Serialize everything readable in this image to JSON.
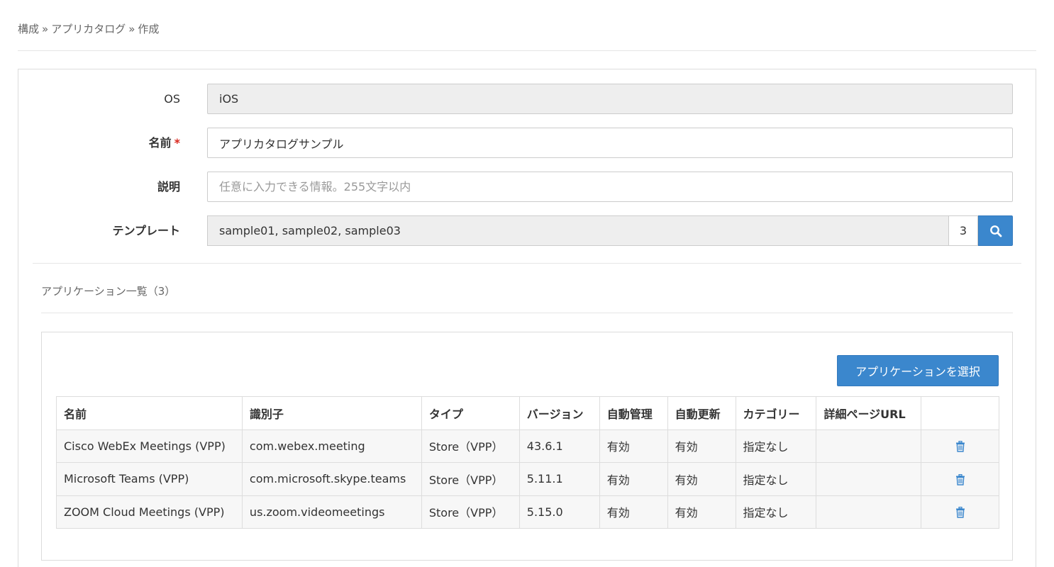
{
  "breadcrumb": {
    "items": [
      "構成",
      "アプリカタログ",
      "作成"
    ],
    "separator": "»"
  },
  "form": {
    "os": {
      "label": "OS",
      "value": "iOS"
    },
    "name": {
      "label": "名前",
      "required_mark": "*",
      "value": "アプリカタログサンプル"
    },
    "description": {
      "label": "説明",
      "value": "",
      "placeholder": "任意に入力できる情報。255文字以内"
    },
    "template": {
      "label": "テンプレート",
      "value": "sample01, sample02, sample03",
      "count": "3",
      "search_icon": "search-icon"
    }
  },
  "app_list": {
    "title": "アプリケーション一覧（3）",
    "select_button": "アプリケーションを選択",
    "columns": [
      "名前",
      "識別子",
      "タイプ",
      "バージョン",
      "自動管理",
      "自動更新",
      "カテゴリー",
      "詳細ページURL",
      ""
    ],
    "rows": [
      {
        "name": "Cisco WebEx Meetings (VPP)",
        "identifier": "com.webex.meeting",
        "type": "Store（VPP）",
        "version": "43.6.1",
        "auto_manage": "有効",
        "auto_update": "有効",
        "category": "指定なし",
        "detail_url": ""
      },
      {
        "name": "Microsoft Teams (VPP)",
        "identifier": "com.microsoft.skype.teams",
        "type": "Store（VPP）",
        "version": "5.11.1",
        "auto_manage": "有効",
        "auto_update": "有効",
        "category": "指定なし",
        "detail_url": ""
      },
      {
        "name": "ZOOM Cloud Meetings (VPP)",
        "identifier": "us.zoom.videomeetings",
        "type": "Store（VPP）",
        "version": "5.15.0",
        "auto_manage": "有効",
        "auto_update": "有効",
        "category": "指定なし",
        "detail_url": ""
      }
    ]
  },
  "colors": {
    "primary": "#3b87cd",
    "required": "#d9261c",
    "readonly_bg": "#eeeeee"
  }
}
